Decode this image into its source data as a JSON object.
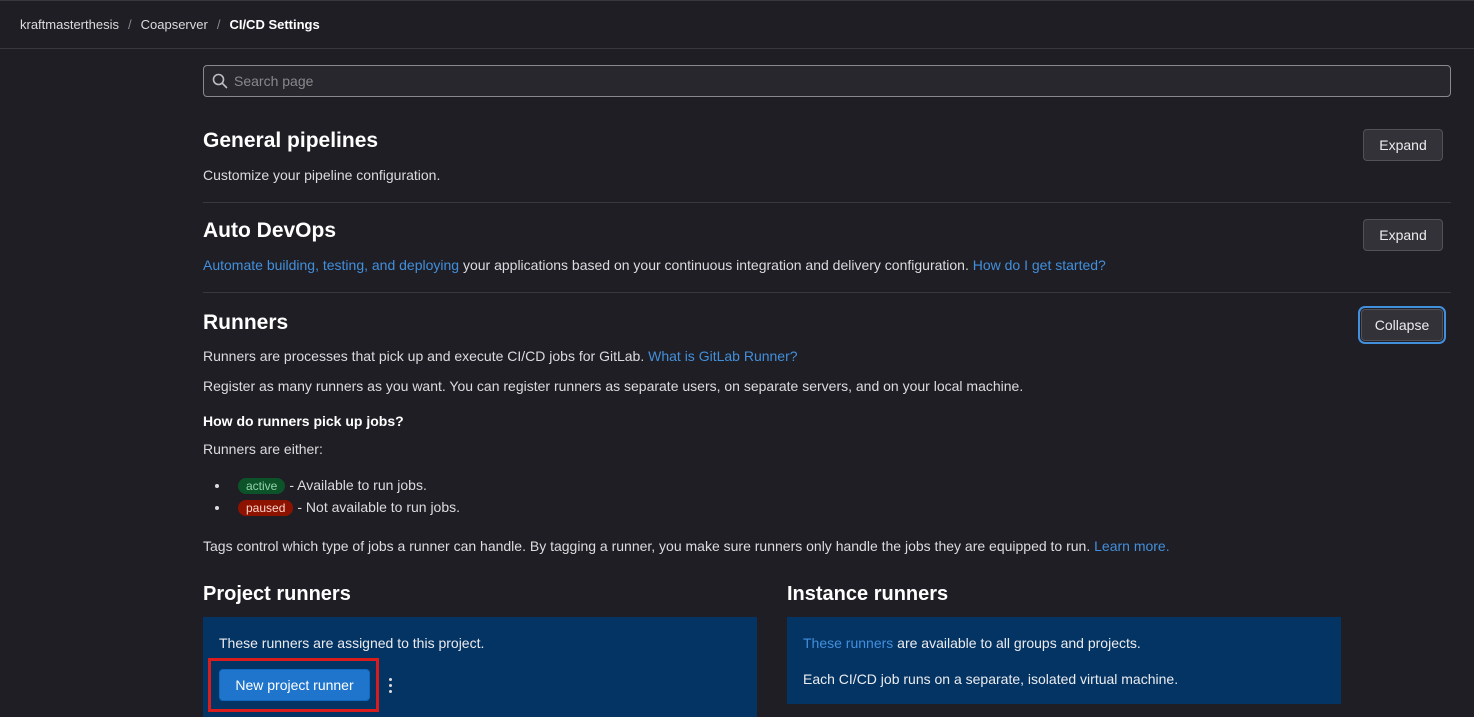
{
  "breadcrumb": [
    "kraftmasterthesis",
    "Coapserver",
    "CI/CD Settings"
  ],
  "search": {
    "placeholder": "Search page"
  },
  "sections": {
    "general": {
      "title": "General pipelines",
      "description": "Customize your pipeline configuration.",
      "button": "Expand"
    },
    "autodevops": {
      "title": "Auto DevOps",
      "link1": "Automate building, testing, and deploying",
      "text": " your applications based on your continuous integration and delivery configuration. ",
      "link2": "How do I get started?",
      "button": "Expand"
    },
    "runners": {
      "title": "Runners",
      "button": "Collapse",
      "intro": "Runners are processes that pick up and execute CI/CD jobs for GitLab. ",
      "intro_link": "What is GitLab Runner?",
      "register": "Register as many runners as you want. You can register runners as separate users, on separate servers, and on your local machine.",
      "howto_heading": "How do runners pick up jobs?",
      "either": "Runners are either:",
      "states": [
        {
          "badge": "active",
          "text": "- Available to run jobs."
        },
        {
          "badge": "paused",
          "text": "- Not available to run jobs."
        }
      ],
      "tags_text": "Tags control which type of jobs a runner can handle. By tagging a runner, you make sure runners only handle the jobs they are equipped to run. ",
      "tags_link": "Learn more."
    }
  },
  "project_runners": {
    "title": "Project runners",
    "text": "These runners are assigned to this project.",
    "button": "New project runner"
  },
  "instance_runners": {
    "title": "Instance runners",
    "link": "These runners",
    "text1": " are available to all groups and projects.",
    "text2": "Each CI/CD job runs on a separate, isolated virtual machine."
  },
  "colors": {
    "background": "#1f1e24",
    "link": "#428fdc",
    "panel": "#033464",
    "primary": "#1f75cb",
    "highlight": "#d91c1c"
  }
}
